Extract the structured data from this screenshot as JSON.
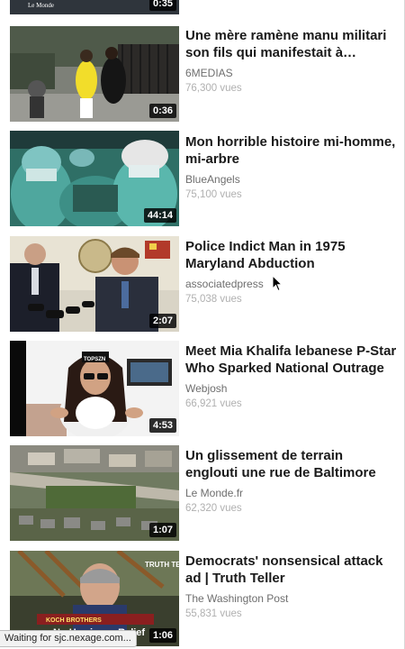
{
  "feed": {
    "partial_item": {
      "duration": "0:35",
      "logo_text": "Le Monde"
    },
    "items": [
      {
        "title": "Une mère ramène manu militari son fils qui manifestait à Baltimore",
        "channel": "6MEDIAS",
        "views": "76,300 vues",
        "duration": "0:36",
        "thumb_icon": "protest-street-thumbnail"
      },
      {
        "title": "Mon horrible histoire mi-homme, mi-arbre",
        "channel": "BlueAngels",
        "views": "75,100 vues",
        "duration": "44:14",
        "thumb_icon": "surgery-room-thumbnail"
      },
      {
        "title": "Police Indict Man in 1975 Maryland Abduction",
        "channel": "associatedpress",
        "views": "75,038 vues",
        "duration": "2:07",
        "thumb_icon": "press-conference-thumbnail"
      },
      {
        "title": "Meet Mia Khalifa lebanese P-Star Who Sparked National Outrage",
        "channel": "Webjosh",
        "views": "66,921 vues",
        "duration": "4:53",
        "thumb_icon": "woman-portrait-thumbnail",
        "cap_text": "TOPSZN"
      },
      {
        "title": "Un glissement de terrain englouti une rue de Baltimore",
        "channel": "Le Monde.fr",
        "views": "62,320 vues",
        "duration": "1:07",
        "thumb_icon": "aerial-landslide-thumbnail"
      },
      {
        "title": "Democrats' nonsensical attack ad | Truth Teller",
        "channel": "The Washington Post",
        "views": "55,831 vues",
        "duration": "1:06",
        "thumb_icon": "truth-teller-thumbnail",
        "overlay_text": "No Hurricane Relief",
        "overlay_top": "KOCH BROTHERS",
        "corner_text": "TRUTH TELLER"
      }
    ]
  },
  "status_bar": {
    "text": "Waiting for sjc.nexage.com..."
  },
  "colors": {
    "title": "#1a1a1a",
    "channel": "#6e6e6e",
    "views": "#b0b0b0",
    "duration_bg": "#000000"
  }
}
